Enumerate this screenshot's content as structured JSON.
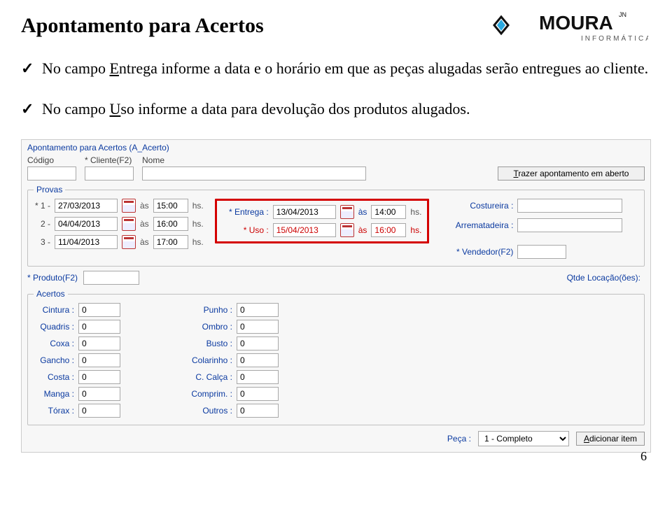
{
  "page_number": "6",
  "doc": {
    "title": "Apontamento para Acertos",
    "bullet1_pre": "No campo ",
    "bullet1_uword": "E",
    "bullet1_rest": "ntrega informe a data e o horário em que as peças alugadas serão entregues ao cliente.",
    "bullet2_pre": "No campo ",
    "bullet2_uword": "U",
    "bullet2_rest": "so informe  a data para devolução dos produtos alugados."
  },
  "logo": {
    "brand": "MOURA",
    "sup": "JN",
    "sub": "INFORMÁTICA"
  },
  "app": {
    "panel_title": "Apontamento para Acertos (A_Acerto)",
    "header": {
      "codigo_lbl": "Código",
      "cliente_lbl": "* Cliente(F2)",
      "nome_lbl": "Nome",
      "trazer_btn_pre": "T",
      "trazer_btn_rest": "razer apontamento em aberto"
    },
    "provas": {
      "legend": "Provas",
      "lines": [
        {
          "num": "* 1 -",
          "date": "27/03/2013",
          "as": "às",
          "time": "15:00",
          "hs": "hs."
        },
        {
          "num": "2 -",
          "date": "04/04/2013",
          "as": "às",
          "time": "16:00",
          "hs": "hs."
        },
        {
          "num": "3 -",
          "date": "11/04/2013",
          "as": "às",
          "time": "17:00",
          "hs": "hs."
        }
      ],
      "entrega_lbl": "* Entrega :",
      "entrega_date": "13/04/2013",
      "entrega_as": "às",
      "entrega_time": "14:00",
      "entrega_hs": "hs.",
      "uso_lbl": "* Uso :",
      "uso_date": "15/04/2013",
      "uso_as": "às",
      "uso_time": "16:00",
      "uso_hs": "hs.",
      "costureira_lbl": "Costureira :",
      "arrematadeira_lbl": "Arrematadeira :",
      "vendedor_lbl": "* Vendedor(F2)"
    },
    "produto": {
      "lbl": "* Produto(F2)",
      "qtde_lbl": "Qtde Locação(ões):"
    },
    "acertos": {
      "legend": "Acertos",
      "left": [
        {
          "lbl": "Cintura :",
          "val": "0"
        },
        {
          "lbl": "Quadris :",
          "val": "0"
        },
        {
          "lbl": "Coxa :",
          "val": "0"
        },
        {
          "lbl": "Gancho :",
          "val": "0"
        },
        {
          "lbl": "Costa :",
          "val": "0"
        },
        {
          "lbl": "Manga :",
          "val": "0"
        },
        {
          "lbl": "Tórax :",
          "val": "0"
        }
      ],
      "right": [
        {
          "lbl": "Punho :",
          "val": "0"
        },
        {
          "lbl": "Ombro :",
          "val": "0"
        },
        {
          "lbl": "Busto :",
          "val": "0"
        },
        {
          "lbl": "Colarinho :",
          "val": "0"
        },
        {
          "lbl": "C. Calça :",
          "val": "0"
        },
        {
          "lbl": "Comprim. :",
          "val": "0"
        },
        {
          "lbl": "Outros :",
          "val": "0"
        }
      ]
    },
    "footer": {
      "peca_lbl": "Peça :",
      "peca_value": "1 - Completo",
      "add_pre": "A",
      "add_rest": "dicionar item"
    }
  }
}
